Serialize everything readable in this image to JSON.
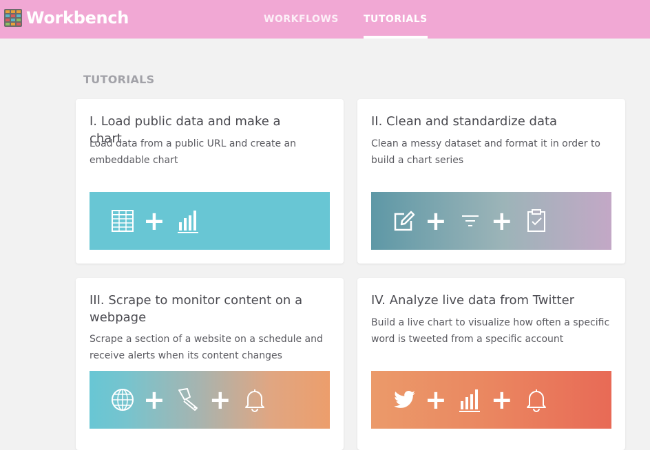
{
  "app": {
    "name": "Workbench"
  },
  "nav": {
    "tabs": [
      {
        "label": "WORKFLOWS",
        "active": false
      },
      {
        "label": "TUTORIALS",
        "active": true
      }
    ]
  },
  "section": {
    "title": "TUTORIALS"
  },
  "colors": {
    "topbar": "#f1a8d4",
    "teal": "#68c6d4",
    "orange": "#ec9e6c",
    "coral": "#e86a56"
  },
  "tutorials": [
    {
      "title": "I. Load public data and make a chart",
      "description": "Load data from a public URL and create an embeddable chart",
      "icons": [
        "table-icon",
        "plus",
        "bar-chart-icon"
      ]
    },
    {
      "title": "II. Clean and standardize data",
      "description": "Clean a messy dataset and format it in order to build a chart series",
      "icons": [
        "edit-icon",
        "plus",
        "filter-icon",
        "plus",
        "clipboard-check-icon"
      ]
    },
    {
      "title": "III. Scrape to monitor content on a webpage",
      "description": "Scrape a section of a website on a schedule and receive alerts when its content changes",
      "icons": [
        "globe-icon",
        "plus",
        "scraper-icon",
        "plus",
        "bell-icon"
      ]
    },
    {
      "title": "IV. Analyze live data from Twitter",
      "description": "Build a live chart to visualize how often a specific word is tweeted from a specific account",
      "icons": [
        "twitter-icon",
        "plus",
        "bar-chart-icon",
        "plus",
        "bell-icon"
      ]
    }
  ],
  "glyphs": {
    "plus": "+"
  }
}
